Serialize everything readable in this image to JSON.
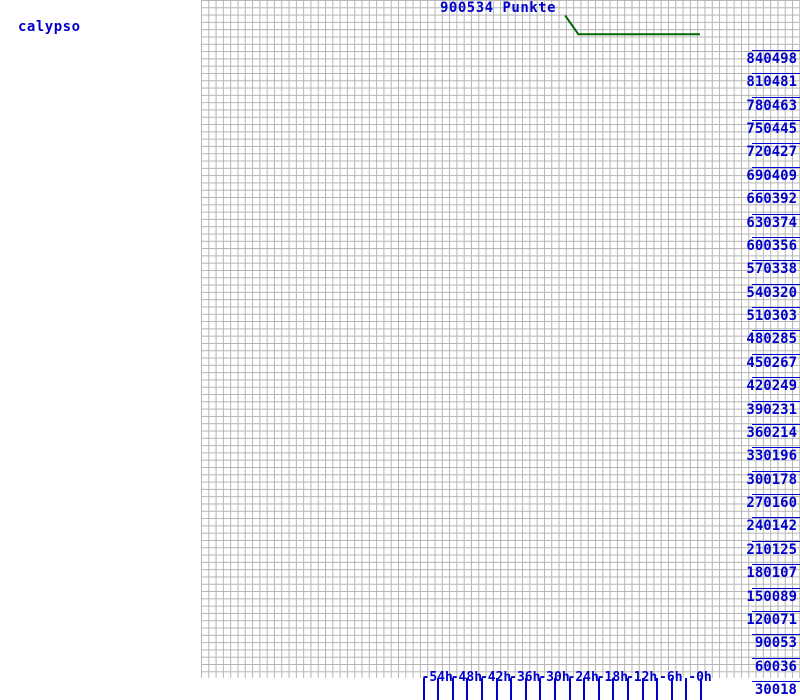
{
  "host": {
    "label": "calypso"
  },
  "header": {
    "title": "900534 Punkte"
  },
  "chart_data": {
    "type": "line",
    "title": "900534 Punkte",
    "xlabel": "",
    "ylabel": "Punkte",
    "grid": true,
    "legend": false,
    "series_color": "#006600",
    "axis_color": "#0000cc",
    "grid_color": "#b4b4b4",
    "background": "#ffffff",
    "xlim": [
      -57.5,
      0
    ],
    "ylim": [
      0,
      900534
    ],
    "x_unit": "h",
    "x_tick_labels": [
      "-54h",
      "-48h",
      "-42h",
      "-36h",
      "-30h",
      "-24h",
      "-18h",
      "-12h",
      "-6h",
      "-0h"
    ],
    "x_tick_values": [
      -54,
      -48,
      -42,
      -36,
      -30,
      -24,
      -18,
      -12,
      -6,
      0
    ],
    "y_tick_labels": [
      "840498",
      "810481",
      "780463",
      "750445",
      "720427",
      "690409",
      "660392",
      "630374",
      "600356",
      "570338",
      "540320",
      "510303",
      "480285",
      "450267",
      "420249",
      "390231",
      "360214",
      "330196",
      "300178",
      "270160",
      "240142",
      "210125",
      "180107",
      "150089",
      "120071",
      "90053",
      "60036",
      "30018"
    ],
    "y_tick_values": [
      840498,
      810481,
      780463,
      750445,
      720427,
      690409,
      660392,
      630374,
      600356,
      570338,
      540320,
      510303,
      480285,
      450267,
      420249,
      390231,
      360214,
      330196,
      300178,
      270160,
      240142,
      210125,
      180107,
      150089,
      120071,
      90053,
      60036,
      30018
    ],
    "series": [
      {
        "name": "Punkte",
        "color": "#006600",
        "points": [
          {
            "x": -27.7,
            "y": 880000
          },
          {
            "x": -25.0,
            "y": 855000
          },
          {
            "x": 0.0,
            "y": 855000
          }
        ]
      }
    ]
  }
}
